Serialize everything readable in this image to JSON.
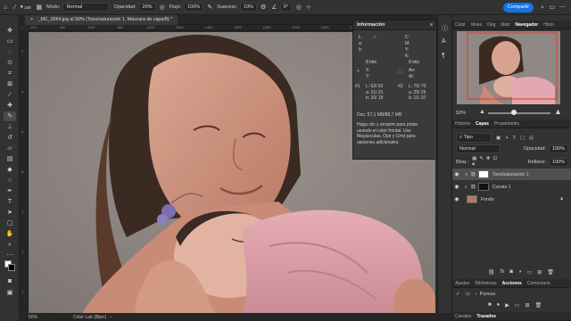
{
  "options_bar": {
    "brush_size": "158",
    "mode_label": "Modo:",
    "mode_value": "Normal",
    "opacity_label": "Opacidad:",
    "opacity_value": "20%",
    "flow_label": "Flujo:",
    "flow_value": "100%",
    "smoothing_label": "Suavizar:",
    "smoothing_value": "10%",
    "angle_value": "0°",
    "share_label": "Compartir"
  },
  "document_tab": {
    "title": "_MC_0064.jpg al 50% (Tono/saturación 1, Máscara de capa/8) *"
  },
  "ruler_top": [
    "200",
    "400",
    "600",
    "800",
    "1000",
    "1200",
    "1400",
    "1600",
    "1800",
    "2000",
    "2200",
    "2400",
    "2600",
    "2800"
  ],
  "ruler_left": [
    "2",
    "4",
    "6",
    "8",
    "1",
    "1",
    "1"
  ],
  "status": {
    "zoom": "50%",
    "color_mode": "Color Lab (8bpc)"
  },
  "info_panel": {
    "title": "Información",
    "top_left": {
      "labels": [
        "L:",
        "a:",
        "b:"
      ],
      "bits": "8 bits"
    },
    "top_right": {
      "labels": [
        "C:",
        "M:",
        "Y:",
        "K:"
      ],
      "bits": "8 bits"
    },
    "xy": {
      "x": "X:",
      "y": "Y:"
    },
    "wh": {
      "w": "An:",
      "h": "Al:"
    },
    "sample1": {
      "label": "#1",
      "l": "L: 62/ 62",
      "a": "a: 21/ 21",
      "b": "b: 20/ 19"
    },
    "sample2": {
      "label": "#2",
      "l": "L: 70/ 70",
      "a": "a: 25/ 26",
      "b": "b: 11/ 10"
    },
    "doc_size": "Doc: 57,1 MB/88,7 MB",
    "hint": "Haga clic y arrastre para pintar usando el color frontal. Use Mayúsculas, Ops y Cmd para opciones adicionales."
  },
  "navigator": {
    "tabs": [
      "Color",
      "Mues",
      "Deg",
      "Matr",
      "Navegador",
      "Histo"
    ],
    "active_tab": "Navegador",
    "zoom": "50%"
  },
  "layers_panel": {
    "tabs": [
      "Historia",
      "Capas",
      "Propiedades"
    ],
    "active_tab": "Capas",
    "filter_label": "Tipo",
    "blend_mode": "Normal",
    "opacity_label": "Opacidad:",
    "opacity_value": "100%",
    "lock_label": "Bloq.:",
    "fill_label": "Relleno:",
    "fill_value": "100%",
    "layers": [
      {
        "name": "Tono/saturación 1",
        "selected": true,
        "thumb_color": "#ffffff"
      },
      {
        "name": "Curvas 1",
        "selected": false,
        "thumb_color": "#111111"
      },
      {
        "name": "Fondo",
        "selected": false,
        "thumb_color": "#b07a66"
      }
    ]
  },
  "actions_panel": {
    "tabs": [
      "Ajustes",
      "Bibliotecas",
      "Acciones",
      "Comentario"
    ],
    "active_tab": "Acciones",
    "items": [
      "Pureza"
    ]
  },
  "bottom_panel": {
    "tabs": [
      "Canales",
      "Trazados"
    ],
    "active_tab": "Trazados"
  },
  "colors": {
    "accent": "#1473e6",
    "foreground": "#ffffff",
    "background": "#000000"
  }
}
